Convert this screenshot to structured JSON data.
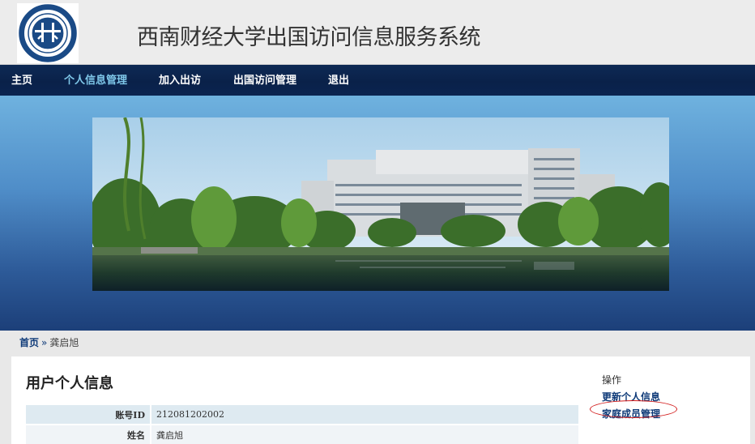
{
  "site": {
    "title": "西南财经大学出国访问信息服务系统",
    "logo_icon": "university-seal-icon",
    "brand_color": "#0b2450",
    "accent_color": "#7fc8ea"
  },
  "nav": {
    "items": [
      {
        "label": "主页",
        "active": false
      },
      {
        "label": "个人信息管理",
        "active": true
      },
      {
        "label": "加入出访",
        "active": false
      },
      {
        "label": "出国访问管理",
        "active": false
      },
      {
        "label": "退出",
        "active": false
      }
    ]
  },
  "breadcrumb": {
    "home": "首页",
    "separator": "»",
    "current": "龚启旭"
  },
  "main": {
    "title": "用户个人信息",
    "rows": [
      {
        "label": "账号ID",
        "value": "212081202002"
      },
      {
        "label": "姓名",
        "value": "龚启旭"
      }
    ]
  },
  "sidebar": {
    "heading": "操作",
    "links": [
      {
        "label": "更新个人信息"
      },
      {
        "label": "家庭成员管理",
        "highlighted": true
      }
    ],
    "highlight_color": "#d21b1b"
  }
}
